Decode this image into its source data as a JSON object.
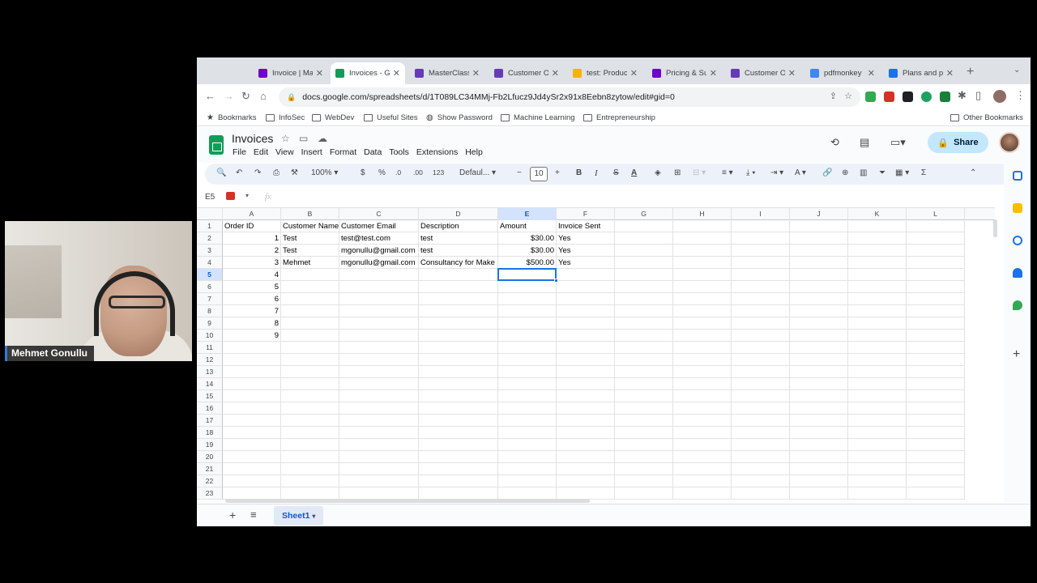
{
  "webcam": {
    "participant_name": "Mehmet Gonullu"
  },
  "browser": {
    "tabs": [
      {
        "title": "Invoice | Ma",
        "icon": "make-icon",
        "color": "#6d00cc"
      },
      {
        "title": "Invoices - G",
        "icon": "sheets-icon",
        "color": "#0f9d58",
        "active": true
      },
      {
        "title": "MasterClass",
        "icon": "forms-icon",
        "color": "#673ab7"
      },
      {
        "title": "Customer O",
        "icon": "forms-icon",
        "color": "#673ab7"
      },
      {
        "title": "test: Produc",
        "icon": "slides-icon",
        "color": "#f4b400"
      },
      {
        "title": "Pricing & Su",
        "icon": "make-icon",
        "color": "#6d00cc"
      },
      {
        "title": "Customer O",
        "icon": "forms-icon",
        "color": "#673ab7"
      },
      {
        "title": "pdfmonkey",
        "icon": "google-icon",
        "color": "#4285f4"
      },
      {
        "title": "Plans and pr",
        "icon": "page-icon",
        "color": "#1a73e8"
      }
    ],
    "new_tab": "+",
    "url": "docs.google.com/spreadsheets/d/1T089LC34MMj-Fb2Lfucz9Jd4ySr2x91x8Eebn8zytow/edit#gid=0",
    "bookmarks": [
      "Bookmarks",
      "InfoSec",
      "WebDev",
      "Useful Sites",
      "Show Password",
      "Machine Learning",
      "Entrepreneurship"
    ],
    "other_bookmarks": "Other Bookmarks"
  },
  "sheets": {
    "title": "Invoices",
    "menu": [
      "File",
      "Edit",
      "View",
      "Insert",
      "Format",
      "Data",
      "Tools",
      "Extensions",
      "Help"
    ],
    "share_label": "Share",
    "toolbar": {
      "zoom": "100%",
      "currency": "$",
      "percent": "%",
      "dec_decrease": ".0",
      "dec_increase": ".00",
      "format_123": "123",
      "font": "Defaul...",
      "font_size": "10",
      "bold": "B",
      "italic": "I",
      "strike": "S",
      "text_color": "A"
    },
    "name_box": "E5",
    "fx": "fx",
    "columns": [
      "A",
      "B",
      "C",
      "D",
      "E",
      "F",
      "G",
      "H",
      "I",
      "J",
      "K",
      "L"
    ],
    "selected_column": "E",
    "selected_row": "5",
    "rows": [
      [
        "Order ID",
        "Customer Name",
        "Customer Email",
        "Description",
        "Amount",
        "Invoice Sent"
      ],
      [
        "1",
        "Test",
        "test@test.com",
        "test",
        "$30.00",
        "Yes"
      ],
      [
        "2",
        "Test",
        "mgonullu@gmail.com",
        "test",
        "$30.00",
        "Yes"
      ],
      [
        "3",
        "Mehmet",
        "mgonullu@gmail.com",
        "Consultancy for Make",
        "$500.00",
        "Yes"
      ],
      [
        "4",
        "",
        "",
        "",
        "",
        ""
      ],
      [
        "5",
        "",
        "",
        "",
        "",
        ""
      ],
      [
        "6",
        "",
        "",
        "",
        "",
        ""
      ],
      [
        "7",
        "",
        "",
        "",
        "",
        ""
      ],
      [
        "8",
        "",
        "",
        "",
        "",
        ""
      ],
      [
        "9",
        "",
        "",
        "",
        "",
        ""
      ]
    ],
    "row_count": 23,
    "sheet_tab": "Sheet1"
  }
}
